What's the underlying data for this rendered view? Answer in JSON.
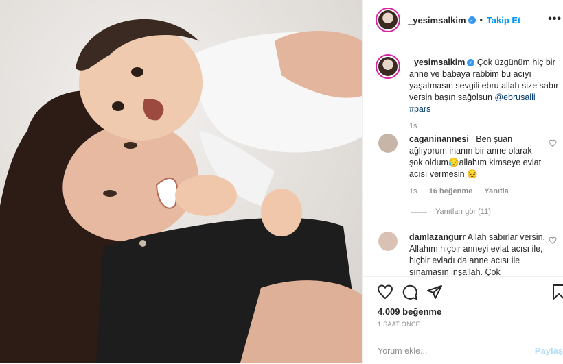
{
  "post": {
    "username": "_yesimsalkim",
    "follow_label": "Takip Et",
    "more_label": "•••",
    "caption": {
      "username": "_yesimsalkim",
      "text": "Çok üzgünüm hiç bir anne ve babaya rabbim bu acıyı yaşatmasın sevgili ebru allah size sabır versin başın sağolsun",
      "mention": "@ebrusalli",
      "hashtag": "#pars",
      "time": "1s"
    },
    "comments": [
      {
        "username": "caganinannesi_",
        "text_before_emoji": "Ben şuan ağlıyorum inanın bir anne olarak şok oldum",
        "emoji1": "😥",
        "text_after_emoji": "allahım kimseye evlat acısı vermesin",
        "emoji2": "😔",
        "time": "1s",
        "likes": "16 beğenme",
        "reply": "Yanıtla",
        "view_replies": "Yanıtları gör (11)"
      },
      {
        "username": "damlazangurr",
        "text": "Allah sabırlar versin. Allahım hiçbir anneyi evlat acısı ile, hiçbir evladı da anne acısı ile sınamasın inşallah. Çok"
      }
    ],
    "like_count": "4.009 beğenme",
    "posted_ago": "1 SAAT ÖNCE",
    "comment_placeholder": "Yorum ekle...",
    "post_button": "Paylaş"
  },
  "colors": {
    "link": "#00376b",
    "follow": "#0095f6",
    "verified": "#3897f0",
    "muted": "#8e8e8e"
  }
}
